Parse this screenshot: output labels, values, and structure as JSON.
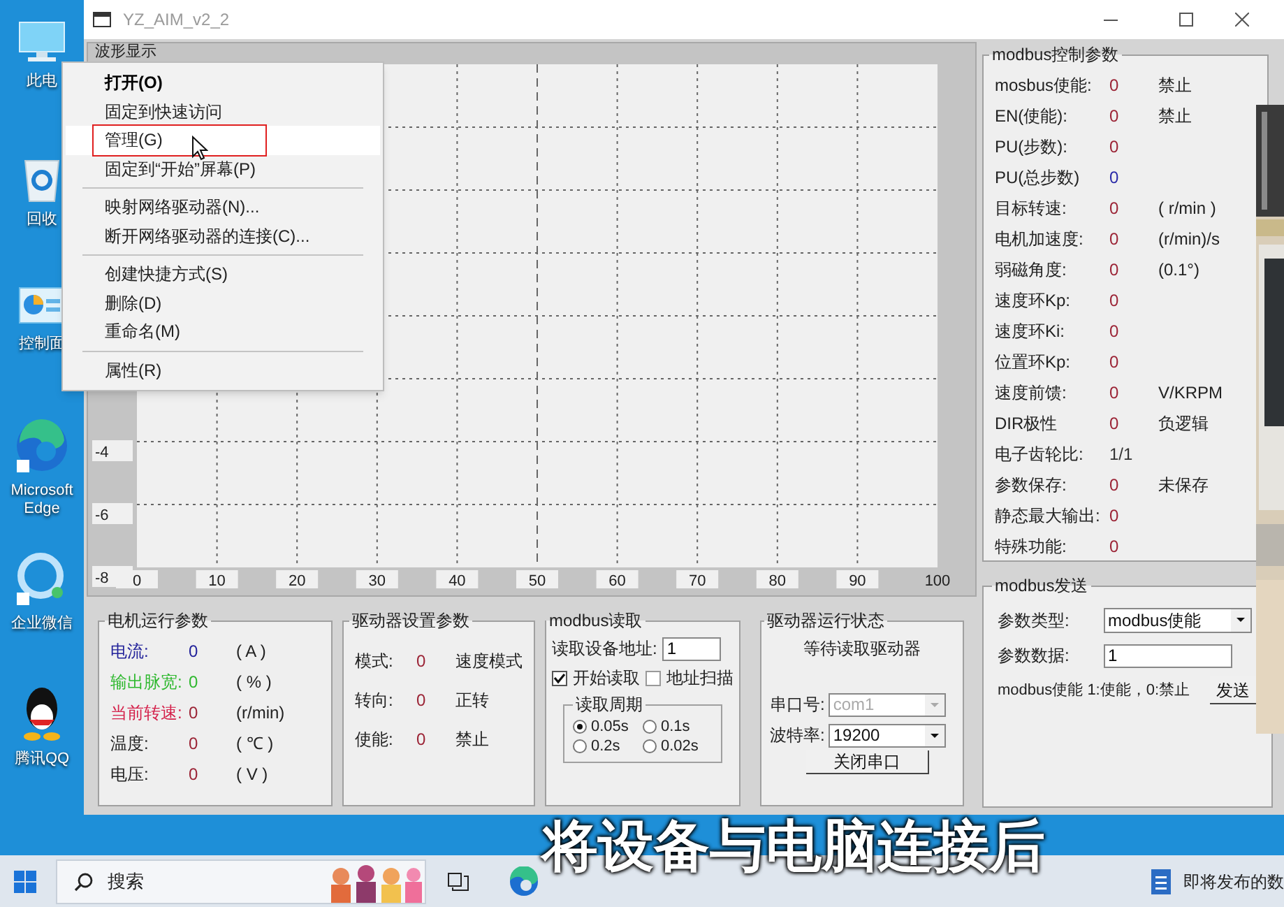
{
  "desktop_icons": [
    {
      "kind": "computer",
      "label": "此电"
    },
    {
      "kind": "recycle",
      "label": "回收"
    },
    {
      "kind": "control",
      "label": "控制面"
    },
    {
      "kind": "edge",
      "label": "Microsoft Edge"
    },
    {
      "kind": "wecom",
      "label": "企业微信"
    },
    {
      "kind": "qq",
      "label": "腾讯QQ"
    }
  ],
  "window": {
    "title": "YZ_AIM_v2_2"
  },
  "waveform": {
    "title": "波形显示",
    "chart_data": {
      "type": "line",
      "grid": true,
      "xlim": [
        0,
        100
      ],
      "ylim": [
        -8,
        8
      ],
      "xticks": [
        0,
        10,
        20,
        30,
        40,
        50,
        60,
        70,
        80,
        90,
        100
      ],
      "yticks": [
        -8,
        -6,
        -4
      ]
    }
  },
  "motor_params": {
    "title": "电机运行参数",
    "rows": [
      {
        "label": {
          "text": "电流:",
          "color": "#22229a"
        },
        "value": {
          "text": "0",
          "color": "#22229a"
        },
        "unit": "( A )"
      },
      {
        "label": {
          "text": "输出脉宽:",
          "color": "#2eb82e"
        },
        "value": {
          "text": "0",
          "color": "#2eb82e"
        },
        "unit": "( % )"
      },
      {
        "label": {
          "text": "当前转速:",
          "color": "#d4204a"
        },
        "value": {
          "text": "0",
          "color": "#9b2335"
        },
        "unit": "(r/min)"
      },
      {
        "label": {
          "text": "温度:",
          "color": "#222222"
        },
        "value": {
          "text": "0",
          "color": "#9b2335"
        },
        "unit": "( ℃ )"
      },
      {
        "label": {
          "text": "电压:",
          "color": "#222222"
        },
        "value": {
          "text": "0",
          "color": "#9b2335"
        },
        "unit": "( V )"
      }
    ]
  },
  "driver_settings": {
    "title": "驱动器设置参数",
    "rows": [
      {
        "label": "模式:",
        "value": "0",
        "unit": "速度模式"
      },
      {
        "label": "转向:",
        "value": "0",
        "unit": "正转"
      },
      {
        "label": "使能:",
        "value": "0",
        "unit": "禁止"
      }
    ]
  },
  "modbus_read": {
    "title": "modbus读取",
    "address_label": "读取设备地址:",
    "address": "1",
    "checkboxes": [
      {
        "label": "开始读取",
        "checked": true
      },
      {
        "label": "地址扫描",
        "checked": false
      }
    ],
    "period": {
      "title": "读取周期",
      "options": [
        {
          "label": "0.05s",
          "selected": true
        },
        {
          "label": "0.1s",
          "selected": false
        },
        {
          "label": "0.2s",
          "selected": false
        },
        {
          "label": "0.02s",
          "selected": false
        }
      ]
    }
  },
  "driver_status": {
    "title": "驱动器运行状态",
    "status": "等待读取驱动器",
    "port_label": "串口号:",
    "port": {
      "value": "com1",
      "disabled": true
    },
    "baud_label": "波特率:",
    "baud": {
      "value": "19200",
      "disabled": false
    },
    "button": "关闭串口"
  },
  "control_params": {
    "title": "modbus控制参数",
    "rows": [
      {
        "label": "mosbus使能:",
        "value": "0",
        "unit": "禁止",
        "color": "#9b2335"
      },
      {
        "label": "EN(使能):",
        "value": "0",
        "unit": "禁止",
        "color": "#9b2335"
      },
      {
        "label": "PU(步数):",
        "value": "0",
        "color": "#9b2335"
      },
      {
        "label": "PU(总步数)",
        "value": "0",
        "color": "#2a2aa8"
      },
      {
        "label": "目标转速:",
        "value": "0",
        "unit": "( r/min )",
        "color": "#9b2335"
      },
      {
        "label": "电机加速度:",
        "value": "0",
        "unit": "(r/min)/s",
        "color": "#9b2335"
      },
      {
        "label": "弱磁角度:",
        "value": "0",
        "unit": "(0.1°)",
        "color": "#9b2335"
      },
      {
        "label": "速度环Kp:",
        "value": "0",
        "color": "#9b2335"
      },
      {
        "label": "速度环Ki:",
        "value": "0",
        "color": "#9b2335"
      },
      {
        "label": "位置环Kp:",
        "value": "0",
        "color": "#9b2335"
      },
      {
        "label": "速度前馈:",
        "value": "0",
        "unit": "V/KRPM",
        "color": "#9b2335"
      },
      {
        "label": "DIR极性",
        "value": "0",
        "unit": "负逻辑",
        "color": "#9b2335"
      },
      {
        "label": "电子齿轮比:",
        "value": "1/1",
        "color": "#333333"
      },
      {
        "label": "参数保存:",
        "value": "0",
        "unit": "未保存",
        "color": "#9b2335"
      },
      {
        "label": "静态最大输出:",
        "value": "0",
        "color": "#9b2335"
      },
      {
        "label": "特殊功能:",
        "value": "0",
        "color": "#9b2335"
      }
    ]
  },
  "modbus_send": {
    "title": "modbus发送",
    "type_label": "参数类型:",
    "type_value": "modbus使能",
    "data_label": "参数数据:",
    "data_value": "1",
    "hint": "modbus使能 1:使能，0:禁止",
    "button": "发送"
  },
  "context_menu": {
    "items": [
      {
        "kind": "item",
        "label": "打开(O)",
        "default": true,
        "selected": false
      },
      {
        "kind": "item",
        "label": "固定到快速访问",
        "default": false,
        "selected": false
      },
      {
        "kind": "item",
        "label": "管理(G)",
        "default": false,
        "selected": true
      },
      {
        "kind": "item",
        "label": "固定到“开始”屏幕(P)",
        "default": false,
        "selected": false
      },
      {
        "kind": "separator"
      },
      {
        "kind": "item",
        "label": "映射网络驱动器(N)...",
        "default": false,
        "selected": false
      },
      {
        "kind": "item",
        "label": "断开网络驱动器的连接(C)...",
        "default": false,
        "selected": false
      },
      {
        "kind": "separator"
      },
      {
        "kind": "item",
        "label": "创建快捷方式(S)",
        "default": false,
        "selected": false
      },
      {
        "kind": "item",
        "label": "删除(D)",
        "default": false,
        "selected": false
      },
      {
        "kind": "item",
        "label": "重命名(M)",
        "default": false,
        "selected": false
      },
      {
        "kind": "separator"
      },
      {
        "kind": "item",
        "label": "属性(R)",
        "default": false,
        "selected": false
      }
    ]
  },
  "taskbar": {
    "search_placeholder": "搜索",
    "notification": "即将发布的数"
  },
  "subtitle": "将设备与电脑连接后"
}
